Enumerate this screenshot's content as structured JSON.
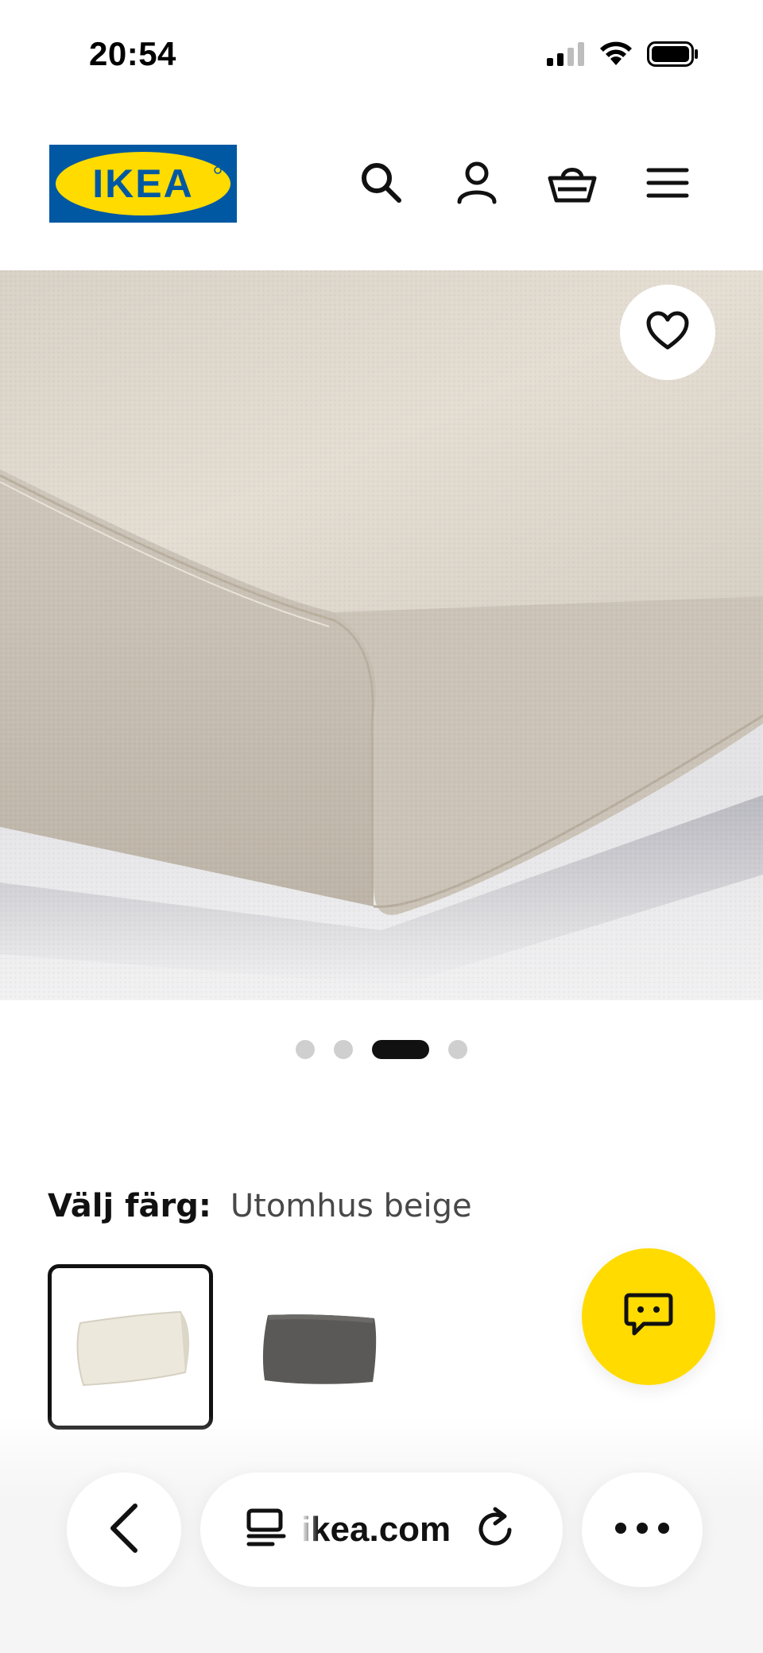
{
  "status_bar": {
    "time": "20:54"
  },
  "header": {
    "logo_text": "IKEA",
    "icons": [
      "search-icon",
      "account-icon",
      "basket-icon",
      "menu-icon"
    ]
  },
  "gallery": {
    "image_count": 4,
    "active_index": 2
  },
  "product": {
    "color_label": "Välj färg:",
    "color_value": "Utomhus beige",
    "swatches": [
      {
        "name": "Utomhus beige",
        "color": "#ece8dc",
        "selected": true
      },
      {
        "name": "Mörkgrå",
        "color": "#5a5957",
        "selected": false
      }
    ]
  },
  "browser": {
    "url": "ikea.com"
  },
  "colors": {
    "ikea_blue": "#0058a3",
    "ikea_yellow": "#ffdb00"
  }
}
